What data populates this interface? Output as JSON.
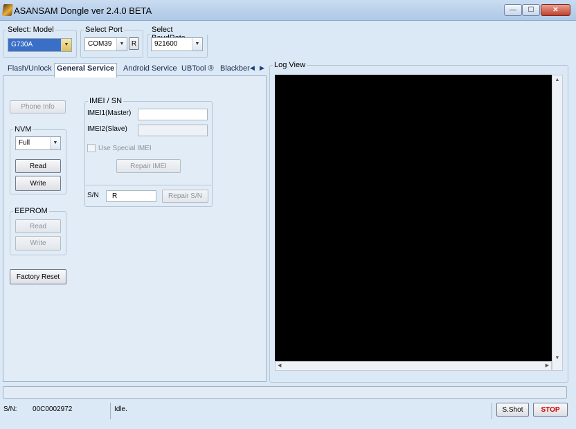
{
  "window": {
    "title": "ASANSAM Dongle ver 2.4.0 BETA",
    "controls": {
      "minimize": "—",
      "maximize": "☐",
      "close": "✕"
    }
  },
  "model": {
    "legend": "Select: Model",
    "value": "G730A"
  },
  "port": {
    "legend": "Select Port",
    "value": "COM39",
    "refresh_label": "R"
  },
  "baud": {
    "legend": "Select BaudRate",
    "value": "921600"
  },
  "tabs": [
    {
      "label": "Flash/Unlock"
    },
    {
      "label": "General Service"
    },
    {
      "label": "Android Service"
    },
    {
      "label": "UBTool ®"
    },
    {
      "label": "Blackber"
    }
  ],
  "tab_scroll": {
    "left": "◀",
    "right": "▶"
  },
  "general": {
    "phone_info_label": "Phone Info",
    "nvm": {
      "legend": "NVM",
      "mode": "Full",
      "read_label": "Read",
      "write_label": "Write"
    },
    "eeprom": {
      "legend": "EEPROM",
      "read_label": "Read",
      "write_label": "Write"
    },
    "factory_reset_label": "Factory Reset",
    "imei": {
      "legend": "IMEI / SN",
      "imei1_label": "IMEI1(Master)",
      "imei2_label": "IMEI2(Slave)",
      "special_label": "Use Special IMEI",
      "repair_imei_label": "Repair IMEI",
      "sn_label": "S/N",
      "sn_value": "R",
      "repair_sn_label": "Repair S/N"
    }
  },
  "log": {
    "title": "Log View"
  },
  "status": {
    "sn_label": "S/N:",
    "sn_value": "00C0002972",
    "state": "Idle.",
    "shot_label": "S.Shot",
    "stop_label": "STOP"
  },
  "colors": {
    "stop": "#d40000",
    "log_bg": "#000000",
    "selected_model_bg": "#3a6fc8"
  }
}
